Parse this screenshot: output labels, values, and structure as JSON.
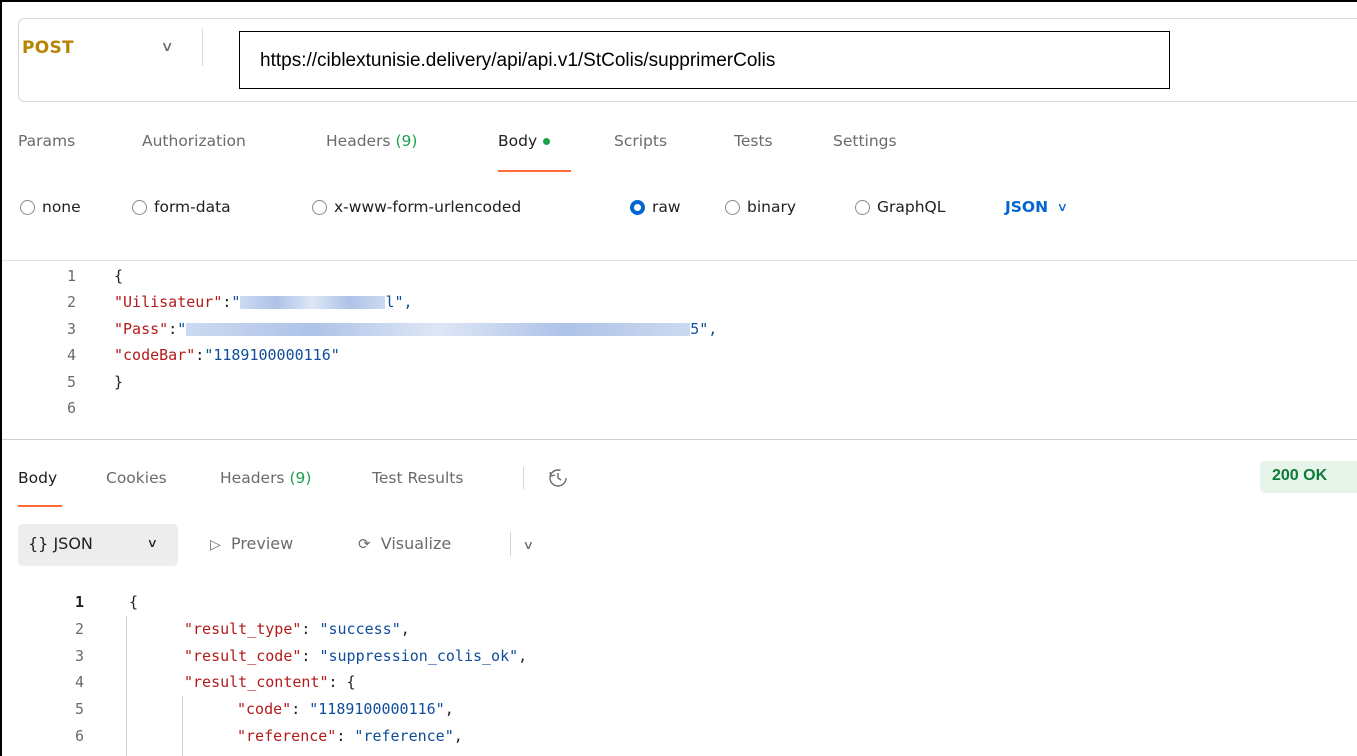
{
  "request": {
    "method": "POST",
    "url": "https://ciblextunisie.delivery/api/api.v1/StColis/supprimerColis"
  },
  "request_tabs": {
    "params": "Params",
    "authorization": "Authorization",
    "headers": "Headers",
    "headers_count": "(9)",
    "body": "Body",
    "scripts": "Scripts",
    "tests": "Tests",
    "settings": "Settings"
  },
  "body_types": {
    "none": "none",
    "form_data": "form-data",
    "urlencoded": "x-www-form-urlencoded",
    "raw": "raw",
    "binary": "binary",
    "graphql": "GraphQL",
    "format": "JSON",
    "selected": "raw"
  },
  "request_body": {
    "line_numbers": [
      "1",
      "2",
      "3",
      "4",
      "5",
      "6"
    ],
    "open_brace": "{",
    "close_brace": "}",
    "key1": "\"Uilisateur\"",
    "key1_tail": "l\",",
    "key2": "\"Pass\"",
    "key2_tail": "5\",",
    "key3": "\"codeBar\"",
    "val3": "\"1189100000116\""
  },
  "response_tabs": {
    "body": "Body",
    "cookies": "Cookies",
    "headers": "Headers",
    "headers_count": "(9)",
    "test_results": "Test Results"
  },
  "response_status": "200 OK",
  "response_toolbar": {
    "format": "{} JSON",
    "preview": "Preview",
    "visualize": "Visualize"
  },
  "response_body": {
    "line_numbers": [
      "1",
      "2",
      "3",
      "4",
      "5",
      "6"
    ],
    "open_brace": "{",
    "k_result_type": "\"result_type\"",
    "v_result_type": "\"success\"",
    "k_result_code": "\"result_code\"",
    "v_result_code": "\"suppression_colis_ok\"",
    "k_result_content": "\"result_content\"",
    "k_code": "\"code\"",
    "v_code": "\"1189100000116\"",
    "k_reference": "\"reference\"",
    "v_reference": "\"reference\""
  }
}
